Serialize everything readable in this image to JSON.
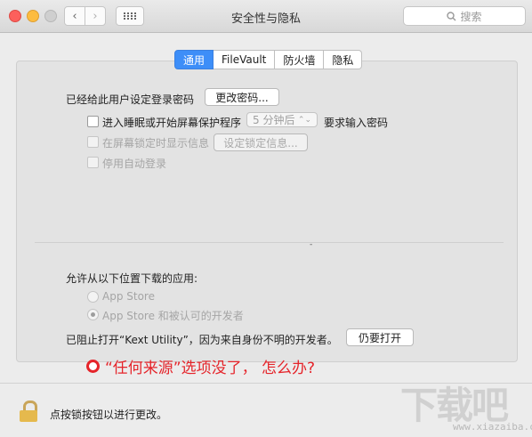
{
  "window": {
    "title": "安全性与隐私",
    "search_placeholder": "搜索",
    "nav": {
      "back_glyph": "‹",
      "forward_glyph": "›"
    },
    "search_icon": "magnifier-icon"
  },
  "tabs": [
    {
      "label": "通用",
      "active": true
    },
    {
      "label": "FileVault",
      "active": false
    },
    {
      "label": "防火墙",
      "active": false
    },
    {
      "label": "隐私",
      "active": false
    }
  ],
  "general": {
    "password_set_label": "已经给此用户设定登录密码",
    "change_password_button": "更改密码...",
    "require_password": {
      "label": "进入睡眠或开始屏幕保护程序",
      "select_value": "5 分钟后",
      "suffix": "要求输入密码"
    },
    "show_message": {
      "label": "在屏幕锁定时显示信息",
      "button": "设定锁定信息..."
    },
    "disable_auto_login": {
      "label": "停用自动登录"
    },
    "dash": "-"
  },
  "downloads": {
    "heading": "允许从以下位置下载的应用:",
    "options": [
      {
        "label": "App Store",
        "selected": false
      },
      {
        "label": "App Store 和被认可的开发者",
        "selected": true
      }
    ],
    "blocked_text": "已阻止打开“Kext Utility”，因为来自身份不明的开发者。",
    "open_anyway_button": "仍要打开"
  },
  "annotation": {
    "text": "“任何来源”选项没了， 怎么办?",
    "color": "#e5242a"
  },
  "footer": {
    "lock_text": "点按锁按钮以进行更改。",
    "lock_icon": "lock-icon"
  },
  "watermark": {
    "text": "下载吧",
    "url": "www.xiazaiba.com"
  },
  "colors": {
    "accent": "#3d8ef8",
    "annotation": "#e5242a",
    "lock": "#e5b94d"
  }
}
